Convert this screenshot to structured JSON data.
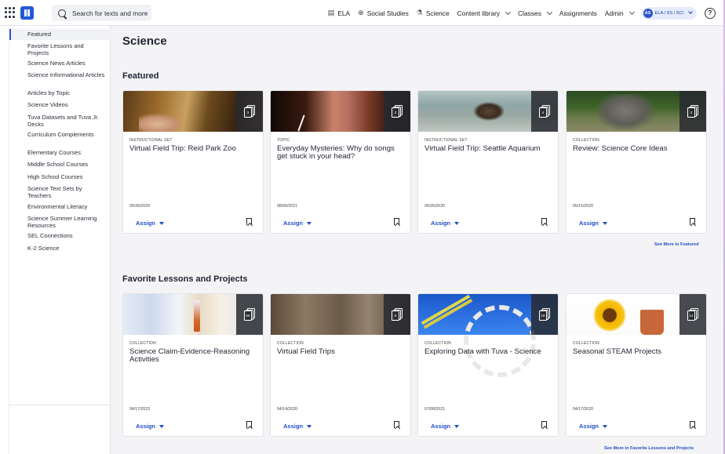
{
  "topbar": {
    "search_placeholder": "Search for texts and more",
    "nav": {
      "ela": "ELA",
      "social_studies": "Social Studies",
      "science": "Science",
      "content_library": "Content library",
      "classes": "Classes",
      "assignments": "Assignments",
      "admin": "Admin"
    },
    "user": {
      "initials": "AS",
      "context": "ELA / SS / SCI"
    },
    "help": "?"
  },
  "sidebar": {
    "items": [
      {
        "label": "Featured"
      },
      {
        "label": "Favorite Lessons and Projects"
      },
      {
        "label": "Science News Articles"
      },
      {
        "label": "Science Informational Articles"
      },
      {
        "label": "Articles by Topic"
      },
      {
        "label": "Science Videos"
      },
      {
        "label": "Tuva Datasets and Tuva Jr. Decks"
      },
      {
        "label": "Curriculum Complements"
      },
      {
        "label": "Elementary Courses"
      },
      {
        "label": "Middle School Courses"
      },
      {
        "label": "High School Courses"
      },
      {
        "label": "Science Text Sets by Teachers"
      },
      {
        "label": "Environmental Literacy"
      },
      {
        "label": "Science Summer Learning Resources"
      },
      {
        "label": "SEL Connections"
      },
      {
        "label": "K-2 Science"
      }
    ]
  },
  "main": {
    "title": "Science",
    "sections": [
      {
        "title": "Featured",
        "see_more": "See More in Featured",
        "cards": [
          {
            "type": "INSTRUCTIONAL SET",
            "title": "Virtual Field Trip: Reid Park Zoo",
            "date": "05/26/2020",
            "count": "3",
            "assign": "Assign"
          },
          {
            "type": "TOPIC",
            "title": "Everyday Mysteries: Why do songs get stuck in your head?",
            "date": "08/06/2021",
            "count": "3",
            "assign": "Assign"
          },
          {
            "type": "INSTRUCTIONAL SET",
            "title": "Virtual Field Trip: Seattle Aquarium",
            "date": "05/26/2020",
            "count": "4",
            "assign": "Assign"
          },
          {
            "type": "COLLECTION",
            "title": "Review: Science Core Ideas",
            "date": "05/15/2020",
            "count": "3",
            "assign": "Assign"
          }
        ]
      },
      {
        "title": "Favorite Lessons and Projects",
        "see_more": "See More in Favorite Lessons and Projects",
        "cards": [
          {
            "type": "COLLECTION",
            "title": "Science Claim-Evidence-Reasoning Activities",
            "date": "04/17/2023",
            "count": "55",
            "assign": "Assign"
          },
          {
            "type": "COLLECTION",
            "title": "Virtual Field Trips",
            "date": "04/14/2020",
            "count": "8",
            "assign": "Assign"
          },
          {
            "type": "COLLECTION",
            "title": "Exploring Data with Tuva - Science",
            "date": "07/08/2021",
            "count": "18",
            "assign": "Assign"
          },
          {
            "type": "COLLECTION",
            "title": "Seasonal STEAM Projects",
            "date": "04/17/2020",
            "count": "14",
            "assign": "Assign"
          }
        ]
      }
    ]
  },
  "colors": {
    "accent": "#1f4fc6",
    "brand": "#1f5bd6",
    "active_indicator": "#2a5bd7"
  }
}
